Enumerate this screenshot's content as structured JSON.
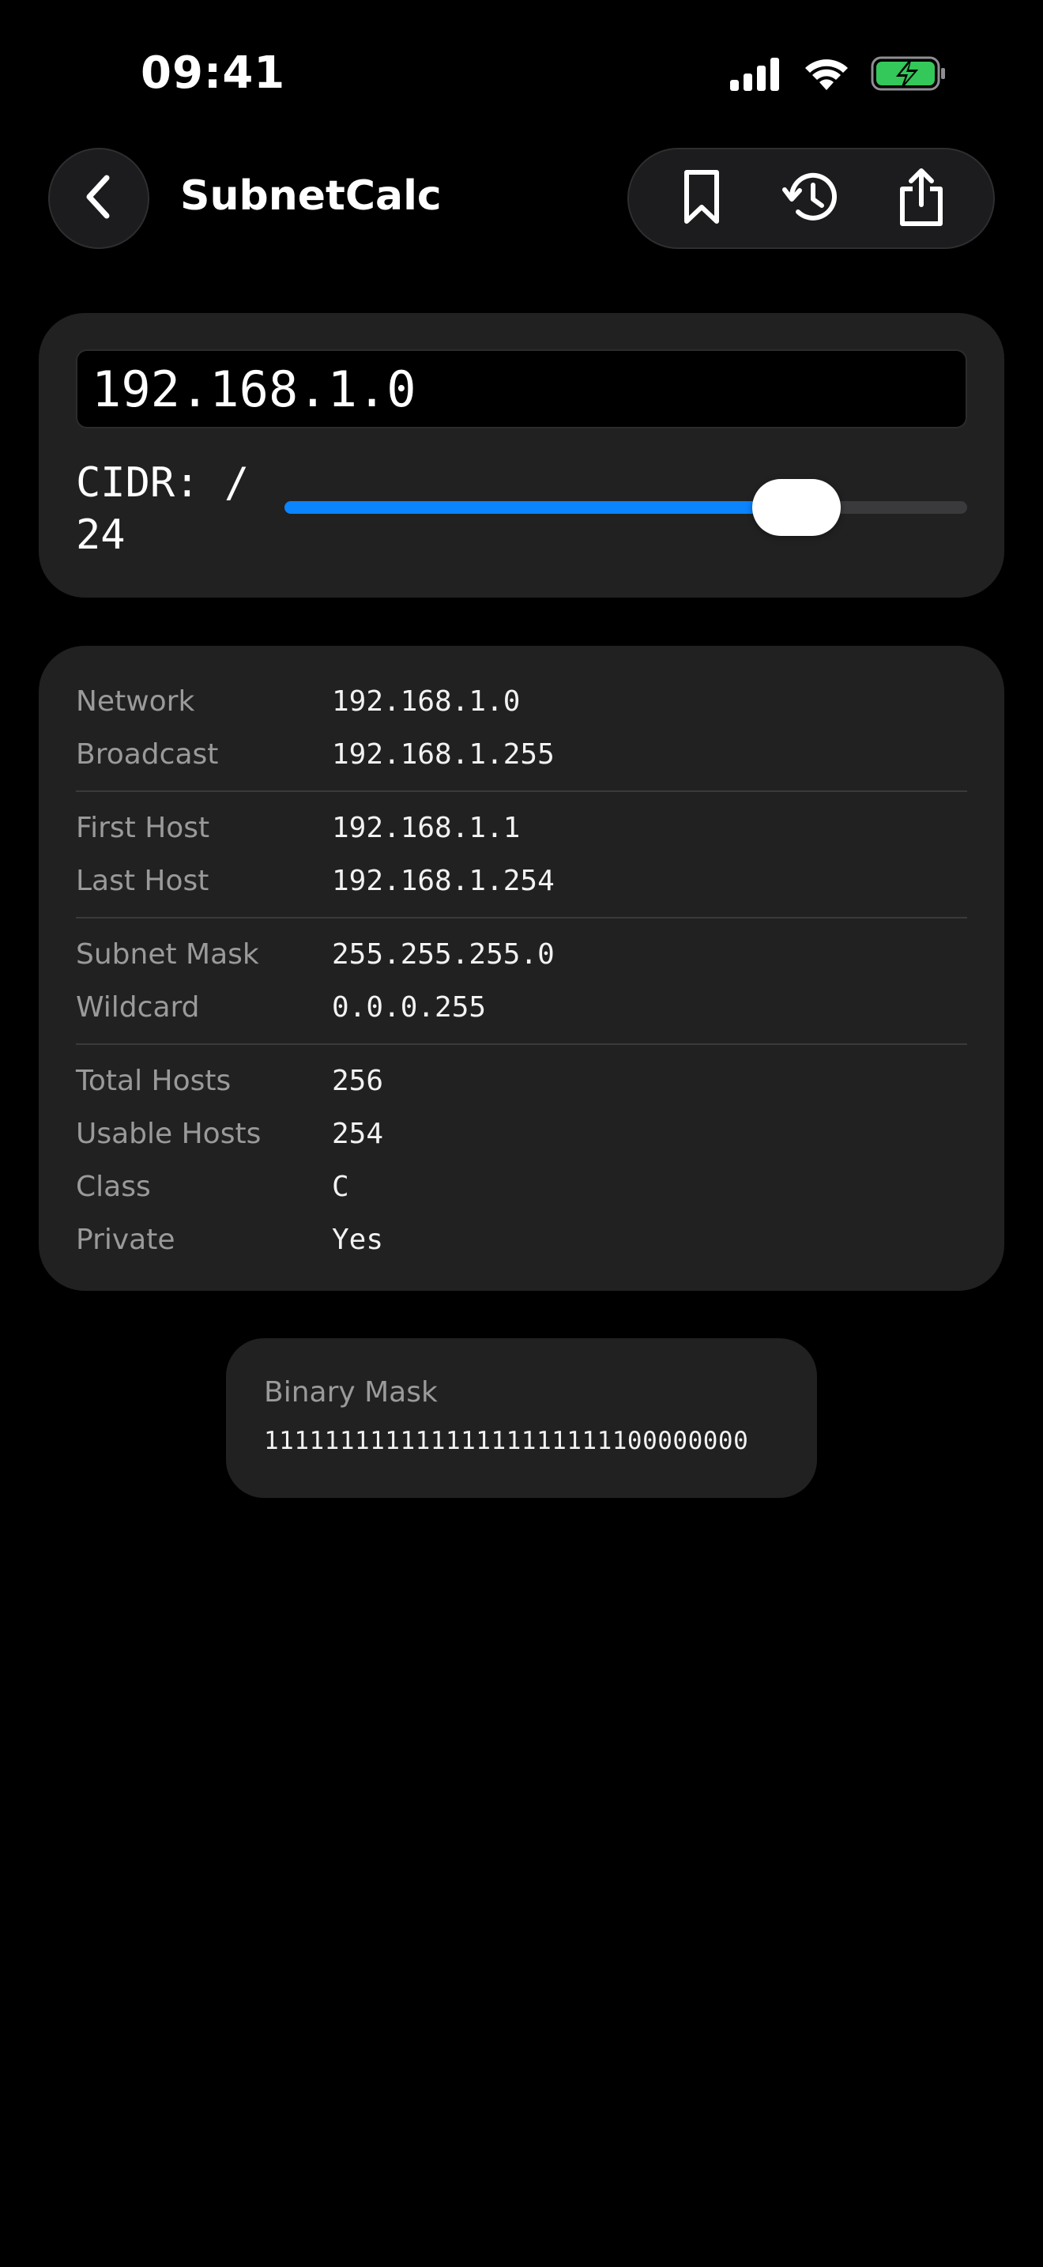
{
  "status_bar": {
    "time": "09:41",
    "signal_icon": "cellular-signal-icon",
    "wifi_icon": "wifi-icon",
    "battery_icon": "battery-charging-icon",
    "battery_color": "#34c759"
  },
  "nav": {
    "back_icon": "chevron-left-icon",
    "title": "SubnetCalc",
    "actions": [
      {
        "icon": "bookmark-icon"
      },
      {
        "icon": "history-icon"
      },
      {
        "icon": "share-icon"
      }
    ]
  },
  "input": {
    "ip_value": "192.168.1.0",
    "cidr_label": "CIDR: / 24",
    "cidr_value": 24,
    "cidr_min": 0,
    "cidr_max": 32,
    "slider_fill_color": "#0a84ff"
  },
  "results": {
    "network_label": "Network",
    "network_value": "192.168.1.0",
    "broadcast_label": "Broadcast",
    "broadcast_value": "192.168.1.255",
    "first_host_label": "First Host",
    "first_host_value": "192.168.1.1",
    "last_host_label": "Last Host",
    "last_host_value": "192.168.1.254",
    "subnet_mask_label": "Subnet Mask",
    "subnet_mask_value": "255.255.255.0",
    "wildcard_label": "Wildcard",
    "wildcard_value": "0.0.0.255",
    "total_hosts_label": "Total Hosts",
    "total_hosts_value": "256",
    "usable_hosts_label": "Usable Hosts",
    "usable_hosts_value": "254",
    "class_label": "Class",
    "class_value": "C",
    "private_label": "Private",
    "private_value": "Yes"
  },
  "binary": {
    "label": "Binary Mask",
    "value": "11111111111111111111111100000000"
  }
}
